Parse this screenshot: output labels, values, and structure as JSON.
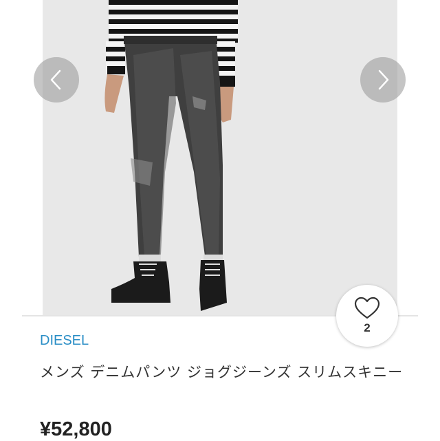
{
  "product": {
    "brand": "DIESEL",
    "title": "メンズ デニムパンツ ジョグジーンズ スリムスキニー",
    "price": "¥52,800",
    "like_count": "2"
  },
  "icons": {
    "prev": "chevron-left-icon",
    "next": "chevron-right-icon",
    "like": "heart-outline-icon"
  },
  "colors": {
    "brand_link": "#2a8ec6",
    "image_background": "#e8e8e8"
  }
}
